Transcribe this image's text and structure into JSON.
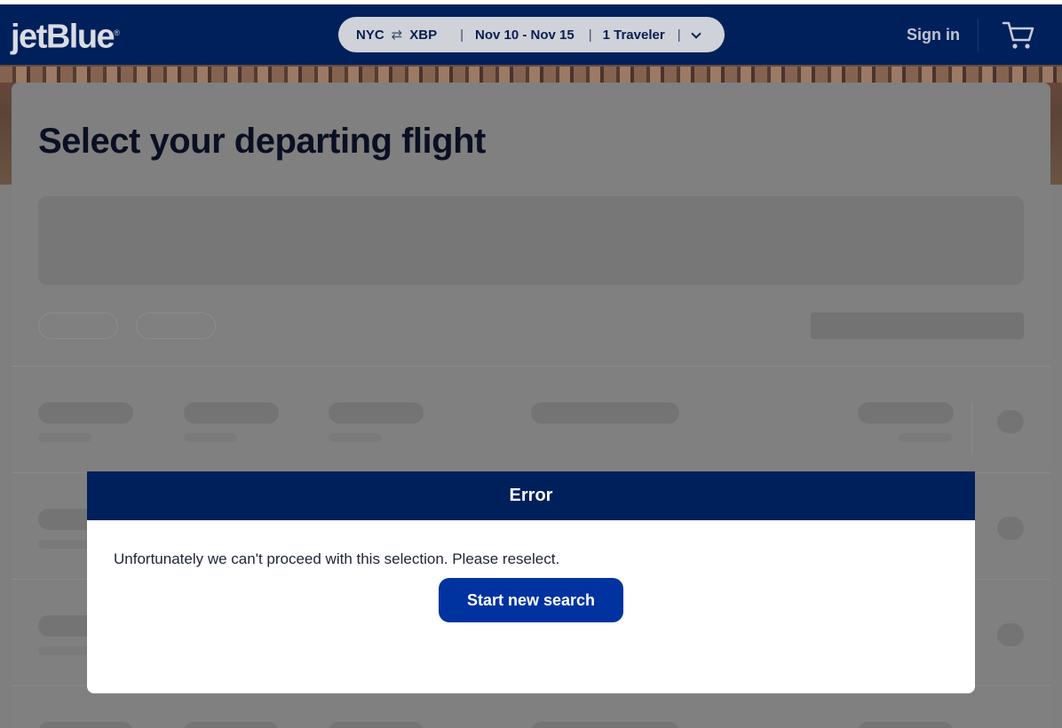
{
  "header": {
    "logo_text": "jetBlue",
    "logo_mark": "®",
    "search_summary": {
      "origin": "NYC",
      "swap_icon": "⇄",
      "destination": "XBP",
      "dates": "Nov 10 - Nov 15",
      "travelers": "1 Traveler",
      "separator": "|"
    },
    "signin_label": "Sign in",
    "cart_icon": "cart-icon"
  },
  "main": {
    "page_title": "Select your departing flight"
  },
  "modal": {
    "title": "Error",
    "message": "Unfortunately we can't proceed with this selection. Please reselect.",
    "button_label": "Start new search"
  },
  "colors": {
    "brand_navy": "#00205b",
    "button_blue": "#0033a0",
    "overlay_gray": "#7f7f7f"
  }
}
